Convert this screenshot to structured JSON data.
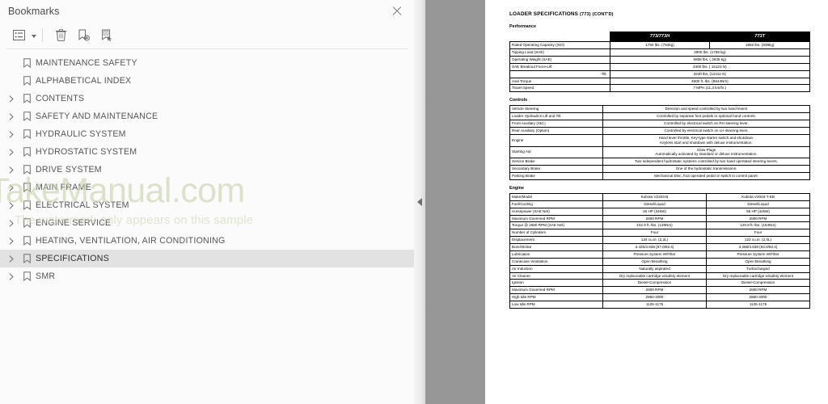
{
  "sidebar": {
    "title": "Bookmarks",
    "close_icon": "close-icon",
    "toolbar": [
      {
        "name": "list-options-icon",
        "label": "Bookmark list options"
      },
      {
        "name": "delete-icon",
        "label": "Delete bookmark"
      },
      {
        "name": "new-bookmark-icon",
        "label": "New bookmark"
      },
      {
        "name": "bookmark-select-icon",
        "label": "Bookmark from selection"
      }
    ],
    "items": [
      {
        "label": "MAINTENANCE SAFETY",
        "expandable": false,
        "selected": false
      },
      {
        "label": "ALPHABETICAL INDEX",
        "expandable": false,
        "selected": false
      },
      {
        "label": "CONTENTS",
        "expandable": true,
        "selected": false
      },
      {
        "label": "SAFETY AND MAINTENANCE",
        "expandable": true,
        "selected": false
      },
      {
        "label": "HYDRAULIC SYSTEM",
        "expandable": true,
        "selected": false
      },
      {
        "label": "HYDROSTATIC SYSTEM",
        "expandable": true,
        "selected": false
      },
      {
        "label": "DRIVE SYSTEM",
        "expandable": true,
        "selected": false
      },
      {
        "label": "MAIN FRAME",
        "expandable": true,
        "selected": false
      },
      {
        "label": "ELECTRICAL SYSTEM",
        "expandable": true,
        "selected": false
      },
      {
        "label": "ENGINE SERVICE",
        "expandable": true,
        "selected": false
      },
      {
        "label": "HEATING, VENTILATION, AIR CONDITIONING",
        "expandable": true,
        "selected": false
      },
      {
        "label": "SPECIFICATIONS",
        "expandable": true,
        "selected": true
      },
      {
        "label": "SMR",
        "expandable": true,
        "selected": false
      }
    ]
  },
  "gutter": {
    "collapse_icon": "collapse-panel-icon"
  },
  "watermark": {
    "main": "TakeManual.com",
    "sub": "The watermark only appears on this sample"
  },
  "document": {
    "title_main": "LOADER SPECIFICATIONS",
    "title_suffix": "(773) (CONT'D)",
    "sections": [
      {
        "label": "Performance",
        "columns": [
          "773/773H",
          "773T"
        ],
        "has_header": true,
        "rows": [
          {
            "label": "Rated Operating Capacity (ISO)",
            "span": false,
            "values": [
              "1750 lbs. (794kg)",
              "1850 lbs. (839kg)"
            ]
          },
          {
            "label": "Tipping Load (SAE)",
            "span": true,
            "values": [
              "3900 lbs. (1769 kg)"
            ]
          },
          {
            "label": "Operating Weight (SAE)",
            "span": true,
            "values": [
              "5808 lbs. ( 2635 kg)"
            ]
          },
          {
            "label": "SAE Breakout Force-Lift",
            "span": true,
            "values": [
              "3400 lbs. ( 15123 N)"
            ]
          },
          {
            "label": "-Tilt",
            "span": true,
            "indent": true,
            "values": [
              "3240 lbs. (14412 N)"
            ]
          },
          {
            "label": "Axel Torque",
            "span": true,
            "values": [
              "4900 ft.-lbs. (6644Nm)"
            ]
          },
          {
            "label": "Travel Speed",
            "span": true,
            "values": [
              "7 MPH (11,3 km/hr.)"
            ]
          }
        ]
      },
      {
        "label": "Controls",
        "columns": [],
        "has_header": false,
        "rows": [
          {
            "label": "Vehicle Steering",
            "span": true,
            "values": [
              "Direction and speed controlled by two hand levers"
            ]
          },
          {
            "label": "Loader Hydraulics Lift and Tilt",
            "span": true,
            "values": [
              "Controlled by separate foot pedals or optional hand controls."
            ]
          },
          {
            "label": "Front Auxiliary (Std.)",
            "span": true,
            "values": [
              "Controlled by electrical switch on RH steering lever."
            ]
          },
          {
            "label": "Rear Auxiliary (Option)",
            "span": true,
            "values": [
              "Controlled by electrical switch on LH steering lever."
            ]
          },
          {
            "label": "Engine",
            "span": true,
            "values": [
              "Hand lever throttle. Key-type starter switch and shutdown.\nKeyless start and shutdown with deluxe instrumentation."
            ]
          },
          {
            "label": "Starting Aid",
            "span": true,
            "values": [
              "Glow Plugs\nAutomatically activated by standard or deluxe instrumentation."
            ]
          },
          {
            "label": "Service Brake",
            "span": true,
            "values": [
              "Two independent hydrostatic systems controlled by two hand opertated steering levers."
            ]
          },
          {
            "label": "Secondary Brake",
            "span": true,
            "values": [
              "One of the hydrostatic transmissions."
            ]
          },
          {
            "label": "Parking Brake",
            "span": true,
            "values": [
              "Mechanical Disc, foot operated pedal or switch in control panel."
            ]
          }
        ]
      },
      {
        "label": "Engine",
        "columns": [],
        "has_header": false,
        "rows": [
          {
            "label": "Make/Model",
            "span": false,
            "values": [
              "Kubota V2203-B",
              "Kubota V2003-T-EB"
            ]
          },
          {
            "label": "Fuel/Cooling",
            "span": false,
            "values": [
              "Diesel/Liquid",
              "Diesel/Liquid"
            ]
          },
          {
            "label": "Horsepower (SAE Net)",
            "span": false,
            "values": [
              "46 HP (34kW)",
              "56 HP (42kW)"
            ]
          },
          {
            "label": "Maximum Governed RPM",
            "span": false,
            "values": [
              "2800 RPM",
              "2800 RPM"
            ]
          },
          {
            "label": "Torque @ 2600 RPM (SAE Net)",
            "span": false,
            "values": [
              "102.5 ft.-lbs. (139Nm)",
              "120.8 ft.-lbs. (164Nm)"
            ]
          },
          {
            "label": "Number of Cylinders",
            "span": false,
            "values": [
              "Four",
              "Four"
            ]
          },
          {
            "label": "Displacement",
            "span": false,
            "values": [
              "134 cu.in. (2,2L)",
              "122 cu.in. (2,0L)"
            ]
          },
          {
            "label": "Bore/Stroke",
            "span": false,
            "values": [
              "3.425/3.638 (87.0/92.4)",
              "3.268/3.638 (83.0/92.4)"
            ]
          },
          {
            "label": "Lubrication",
            "span": false,
            "values": [
              "Pressure System W/Filter",
              "Pressure System W/Filter"
            ]
          },
          {
            "label": "Crankcase Ventilation",
            "span": false,
            "values": [
              "Open Breathing",
              "Open Breathing"
            ]
          },
          {
            "label": "Air Induction",
            "span": false,
            "values": [
              "Naturally aspirated",
              "Turbocharged"
            ]
          },
          {
            "label": "Air Cleaner",
            "span": false,
            "values": [
              "Dry replaceable cartridge w/safety element",
              "Dry replaceable cartridge w/safety element"
            ]
          },
          {
            "label": "Ignition",
            "span": false,
            "values": [
              "Diesel-Compression",
              "Diesel-Compression"
            ]
          },
          {
            "label": "Maximum Governed RPM",
            "span": false,
            "values": [
              "2800 RPM",
              "2800 RPM"
            ]
          },
          {
            "label": "High Idle RPM",
            "span": false,
            "values": [
              "2860-3000",
              "2860-3000"
            ]
          },
          {
            "label": "Low Idle RPM",
            "span": false,
            "values": [
              "1125-1175",
              "1125-1175"
            ]
          }
        ]
      }
    ]
  }
}
